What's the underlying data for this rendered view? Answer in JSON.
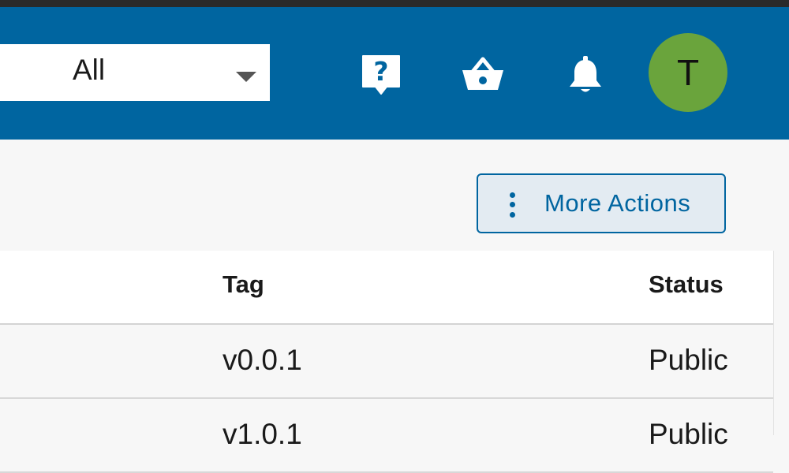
{
  "header": {
    "scope_select": {
      "value": "All"
    },
    "icons": {
      "help": "help-icon",
      "basket": "basket-icon",
      "notifications": "bell-icon"
    },
    "avatar": {
      "initial": "T",
      "color": "#6aa43c"
    },
    "background": "#0065a0"
  },
  "toolbar": {
    "more_actions_label": "More Actions"
  },
  "table": {
    "columns": {
      "tag": "Tag",
      "status": "Status"
    },
    "rows": [
      {
        "tag": "v0.0.1",
        "status": "Public"
      },
      {
        "tag": "v1.0.1",
        "status": "Public"
      }
    ]
  }
}
